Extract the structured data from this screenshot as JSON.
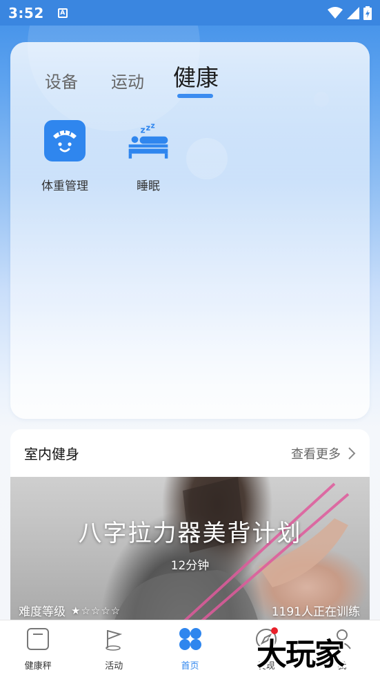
{
  "status_bar": {
    "time": "3:52",
    "notification_letter": "A"
  },
  "health_tabs": {
    "items": [
      "设备",
      "运动",
      "健康"
    ],
    "active": "健康"
  },
  "health_tiles": [
    {
      "label": "体重管理",
      "icon": "scale-face-icon"
    },
    {
      "label": "睡眠",
      "icon": "sleep-bed-icon"
    }
  ],
  "fitness": {
    "title": "室内健身",
    "more_label": "查看更多",
    "banner": {
      "title": "八字拉力器美背计划",
      "duration": "12分钟",
      "difficulty_label": "难度等级",
      "stars": "★☆☆☆☆",
      "difficulty_level": 1,
      "difficulty_max": 5,
      "trainees": "1191人正在训练"
    }
  },
  "bottom_nav": [
    {
      "label": "健康秤",
      "icon": "scale-icon",
      "active": false
    },
    {
      "label": "活动",
      "icon": "flag-icon",
      "active": false
    },
    {
      "label": "首页",
      "icon": "home-clover-icon",
      "active": true
    },
    {
      "label": "发现",
      "icon": "compass-icon",
      "active": false
    },
    {
      "label": "我",
      "icon": "profile-icon",
      "active": false
    }
  ],
  "watermark": "大玩家",
  "colors": {
    "accent": "#2f86ee",
    "status_bar": "#3a86e0",
    "badge_red": "#e8202a"
  }
}
